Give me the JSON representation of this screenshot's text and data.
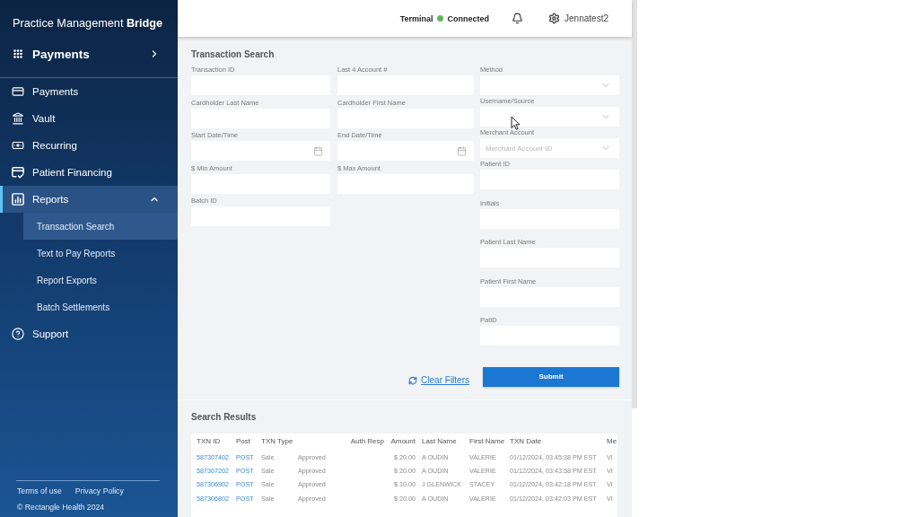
{
  "sidebar": {
    "logo": "Practice Management **Bridge**",
    "module": {
      "label": "Payments"
    },
    "items": [
      {
        "label": "Payments",
        "selected": false
      },
      {
        "label": "Vault",
        "selected": false
      },
      {
        "label": "Recurring",
        "selected": false
      },
      {
        "label": "Patient Financing",
        "selected": false
      },
      {
        "label": "Reports",
        "selected": true,
        "expanded": true,
        "children": [
          {
            "label": "Transaction Search",
            "selected": true
          },
          {
            "label": "Text to Pay Reports",
            "selected": false
          },
          {
            "label": "Report Exports",
            "selected": false
          },
          {
            "label": "Batch Settlements",
            "selected": false
          }
        ]
      },
      {
        "label": "Support",
        "selected": false
      }
    ],
    "footer": {
      "links": [
        "Terms of use",
        "Privacy Policy"
      ],
      "copyright": "© Rectangle Health 2024"
    }
  },
  "top_bar": {
    "terminal": {
      "label": "Terminal",
      "status": "Connected",
      "connected": true
    },
    "user": "Jennatest2"
  },
  "transaction_search": {
    "title": "Transaction Search",
    "field_columns": [
      [
        {
          "label": "Transaction ID",
          "kind": "text"
        },
        {
          "label": "Cardholder Last Name",
          "kind": "text"
        },
        {
          "label": "Start Date/Time",
          "kind": "date"
        },
        {
          "label": "$ Min Amount",
          "kind": "text"
        },
        {
          "label": "Batch ID",
          "kind": "text"
        }
      ],
      [
        {
          "label": "Last 4 Account #",
          "kind": "text"
        },
        {
          "label": "Cardholder First Name",
          "kind": "text"
        },
        {
          "label": "End Date/Time",
          "kind": "date"
        },
        {
          "label": "$ Max Amount",
          "kind": "text"
        }
      ],
      [
        {
          "label": "Method",
          "kind": "select"
        },
        {
          "label": "Username/Source",
          "kind": "select"
        },
        {
          "label": "Merchant Account",
          "kind": "select",
          "placeholder": "Merchant Account ID"
        },
        {
          "label": "Patient ID",
          "kind": "text"
        },
        {
          "label": "Initials",
          "kind": "text"
        },
        {
          "label": "Patient Last Name",
          "kind": "text"
        },
        {
          "label": "Patient First Name",
          "kind": "text"
        },
        {
          "label": "PatID",
          "kind": "text"
        }
      ]
    ],
    "clear_filters": "Clear Filters",
    "submit": "Submit"
  },
  "search_results": {
    "title": "Search Results",
    "columns": [
      {
        "label": "TXN ID",
        "kind": "link"
      },
      {
        "label": "Post",
        "kind": "link"
      },
      {
        "label": "TXN Type",
        "kind": "text"
      },
      {
        "label": "Auth Resp",
        "kind": "status"
      },
      {
        "label": "Amount",
        "kind": "amount"
      },
      {
        "label": "Last Name",
        "kind": "text"
      },
      {
        "label": "First Name",
        "kind": "text"
      },
      {
        "label": "TXN Date",
        "kind": "text"
      },
      {
        "label": "Me",
        "kind": "text"
      }
    ],
    "rows": [
      [
        "587307402",
        "POST",
        "Sale",
        "Approved",
        "$ 20.00",
        "A OUDIN",
        "VALERIE",
        "01/12/2024, 03:45:38 PM EST",
        "VI"
      ],
      [
        "587307202",
        "POST",
        "Sale",
        "Approved",
        "$ 20.00",
        "A OUDIN",
        "VALERIE",
        "01/12/2024, 03:43:58 PM EST",
        "VI"
      ],
      [
        "587306902",
        "POST",
        "Sale",
        "Approved",
        "$ 10.00",
        "J GLENWICK",
        "STACEY",
        "01/12/2024, 03:42:18 PM EST",
        "VI"
      ],
      [
        "587306802",
        "POST",
        "Sale",
        "Approved",
        "$ 20.00",
        "A OUDIN",
        "VALERIE",
        "01/12/2024, 03:42:03 PM EST",
        "VI"
      ]
    ]
  }
}
